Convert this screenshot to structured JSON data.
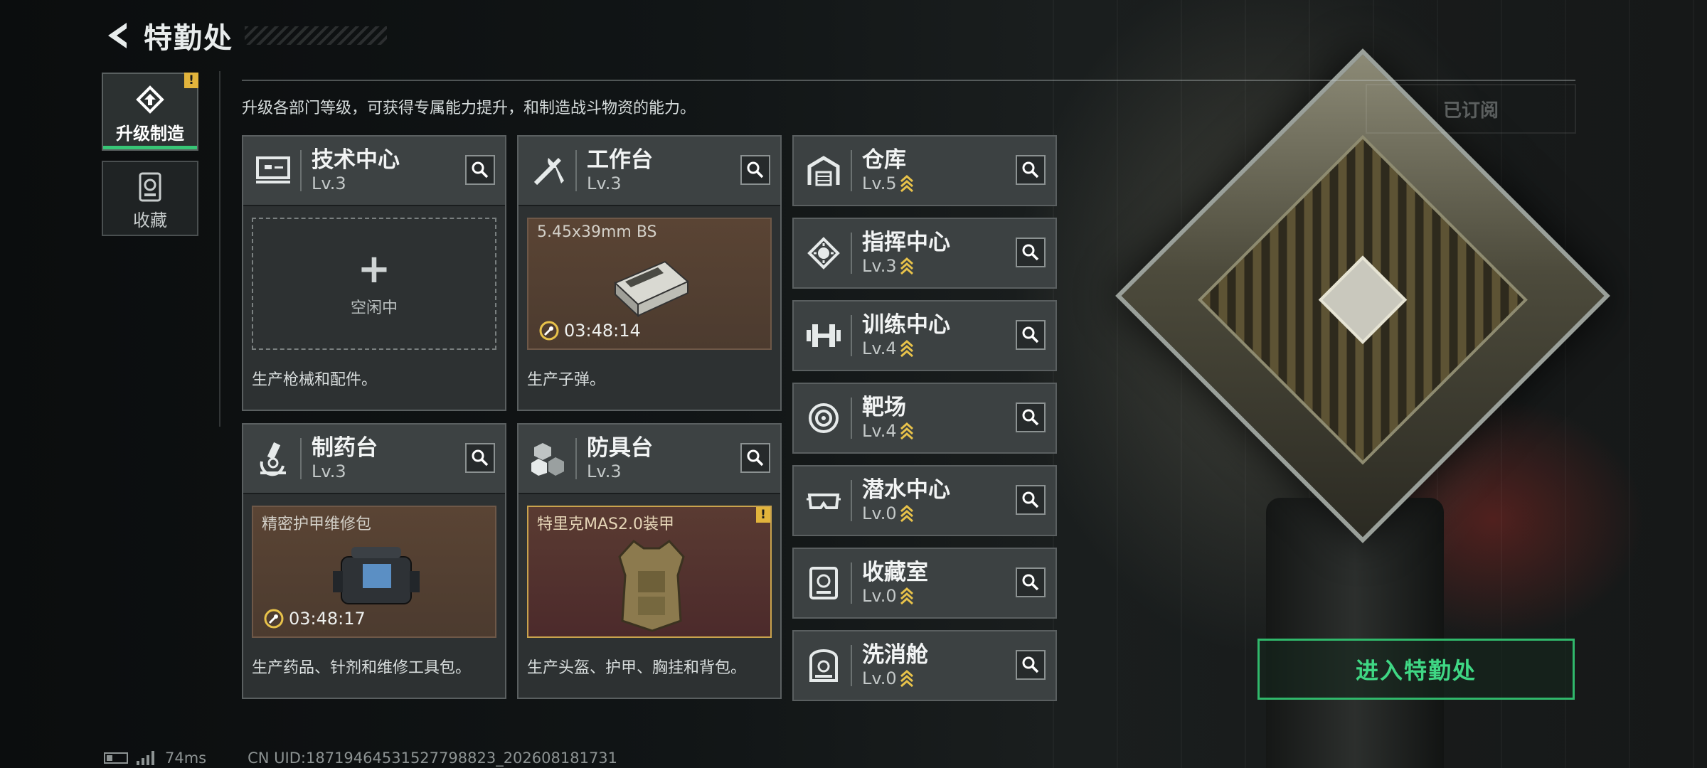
{
  "header": {
    "title": "特勤处"
  },
  "nav": {
    "tabs": [
      {
        "label": "升级制造",
        "active": true,
        "badge": "!"
      },
      {
        "label": "收藏",
        "active": false
      }
    ]
  },
  "description": "升级各部门等级，可获得专属能力提升，和制造战斗物资的能力。",
  "subscribe_label": "已订阅",
  "cards": [
    {
      "name": "技术中心",
      "level": "Lv.3",
      "icon": "monitor-icon",
      "slot": {
        "state": "idle",
        "text": "空闲中"
      },
      "desc": "生产枪械和配件。"
    },
    {
      "name": "工作台",
      "level": "Lv.3",
      "icon": "tools-icon",
      "slot": {
        "state": "producing",
        "item": "5.45x39mm BS",
        "timer": "03:48:14"
      },
      "desc": "生产子弹。"
    },
    {
      "name": "制药台",
      "level": "Lv.3",
      "icon": "microscope-icon",
      "slot": {
        "state": "producing",
        "item": "精密护甲维修包",
        "timer": "03:48:17"
      },
      "desc": "生产药品、针剂和维修工具包。"
    },
    {
      "name": "防具台",
      "level": "Lv.3",
      "icon": "cubes-icon",
      "slot": {
        "state": "ready",
        "item": "特里克MAS2.0装甲",
        "badge": "!"
      },
      "desc": "生产头盔、护甲、胸挂和背包。"
    }
  ],
  "buildings": [
    {
      "name": "仓库",
      "level": "Lv.5",
      "icon": "warehouse-icon"
    },
    {
      "name": "指挥中心",
      "level": "Lv.3",
      "icon": "chip-icon"
    },
    {
      "name": "训练中心",
      "level": "Lv.4",
      "icon": "dumbbell-icon"
    },
    {
      "name": "靶场",
      "level": "Lv.4",
      "icon": "target-icon"
    },
    {
      "name": "潜水中心",
      "level": "Lv.0",
      "icon": "diving-mask-icon"
    },
    {
      "name": "收藏室",
      "level": "Lv.0",
      "icon": "trophy-case-icon"
    },
    {
      "name": "洗消舱",
      "level": "Lv.0",
      "icon": "decon-pod-icon"
    }
  ],
  "enter_button": "进入特勤处",
  "footer": {
    "ping": "74ms",
    "uid": "CN UID:18719464531527798823_202608181731"
  },
  "colors": {
    "accent": "#37c676",
    "warning": "#e2b43c",
    "upgrade": "#e8c24a"
  }
}
